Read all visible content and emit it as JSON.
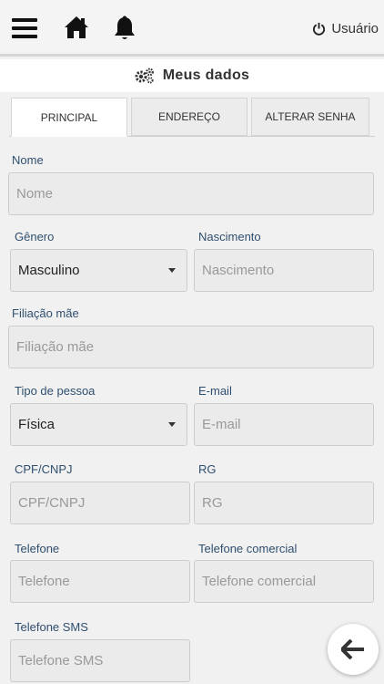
{
  "header": {
    "user_label": "Usuário",
    "icons": [
      "menu-icon",
      "home-icon",
      "bell-icon",
      "power-icon"
    ]
  },
  "page": {
    "title": "Meus dados",
    "title_icon": "gears-icon"
  },
  "tabs": [
    {
      "label": "PRINCIPAL",
      "active": true
    },
    {
      "label": "ENDEREÇO",
      "active": false
    },
    {
      "label": "ALTERAR SENHA",
      "active": false
    }
  ],
  "form": {
    "nome": {
      "label": "Nome",
      "placeholder": "Nome"
    },
    "genero": {
      "label": "Gênero",
      "value": "Masculino"
    },
    "nascimento": {
      "label": "Nascimento",
      "placeholder": "Nascimento"
    },
    "filiacao": {
      "label": "Filiação mãe",
      "placeholder": "Filiação mãe"
    },
    "tipo_pessoa": {
      "label": "Tipo de pessoa",
      "value": "Física"
    },
    "email": {
      "label": "E-mail",
      "placeholder": "E-mail"
    },
    "cpf": {
      "label": "CPF/CNPJ",
      "placeholder": "CPF/CNPJ"
    },
    "rg": {
      "label": "RG",
      "placeholder": "RG"
    },
    "telefone": {
      "label": "Telefone",
      "placeholder": "Telefone"
    },
    "telefone_comercial": {
      "label": "Telefone comercial",
      "placeholder": "Telefone comercial"
    },
    "telefone_sms": {
      "label": "Telefone SMS",
      "placeholder": "Telefone SMS"
    }
  },
  "colors": {
    "label": "#2f4f6f",
    "field_bg": "#ebebeb",
    "background": "#f1f1f1"
  },
  "fab": {
    "icon": "arrow-left-icon"
  }
}
